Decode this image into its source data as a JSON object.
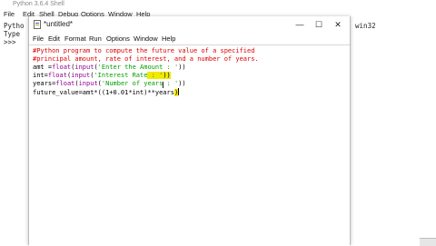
{
  "shell": {
    "title": "Python 3.6.4 Shell",
    "menu": [
      "File",
      "Edit",
      "Shell",
      "Debug",
      "Options",
      "Window",
      "Help"
    ],
    "line1_left": "Pytho",
    "line1_right": "n win32",
    "line2_left": "Type",
    "line3_left": ">>>"
  },
  "editor": {
    "title": "*untitled*",
    "window_controls": {
      "minimize": "—",
      "maximize": "☐",
      "close": "✕"
    },
    "menu": [
      "File",
      "Edit",
      "Format",
      "Run",
      "Options",
      "Window",
      "Help"
    ],
    "code": [
      {
        "segments": [
          {
            "t": "#Python program to compute the future value of a specified",
            "c": "cmt"
          }
        ]
      },
      {
        "segments": [
          {
            "t": "#principal amount, rate of interest, and a number of years.",
            "c": "cmt"
          }
        ]
      },
      {
        "segments": [
          {
            "t": "amt =",
            "c": ""
          },
          {
            "t": "float",
            "c": "bi"
          },
          {
            "t": "(",
            "c": ""
          },
          {
            "t": "input",
            "c": "bi"
          },
          {
            "t": "(",
            "c": ""
          },
          {
            "t": "'Enter the Amount : '",
            "c": "str"
          },
          {
            "t": "))",
            "c": ""
          }
        ]
      },
      {
        "segments": [
          {
            "t": "int=",
            "c": ""
          },
          {
            "t": "float",
            "c": "bi"
          },
          {
            "t": "(",
            "c": ""
          },
          {
            "t": "input",
            "c": "bi"
          },
          {
            "t": "(",
            "c": ""
          },
          {
            "t": "'Interest Rate",
            "c": "str"
          },
          {
            "t": " : '",
            "c": "str sel"
          },
          {
            "t": "))",
            "c": "sel"
          }
        ]
      },
      {
        "segments": [
          {
            "t": "years=",
            "c": ""
          },
          {
            "t": "float",
            "c": "bi"
          },
          {
            "t": "(",
            "c": ""
          },
          {
            "t": "input",
            "c": "bi"
          },
          {
            "t": "(",
            "c": ""
          },
          {
            "t": "'Number of years : '",
            "c": "str"
          },
          {
            "t": "))",
            "c": ""
          }
        ]
      },
      {
        "segments": [
          {
            "t": "future_value=amt*((1+0.01*int)**years",
            "c": ""
          },
          {
            "t": ")",
            "c": "sel"
          }
        ]
      }
    ]
  }
}
